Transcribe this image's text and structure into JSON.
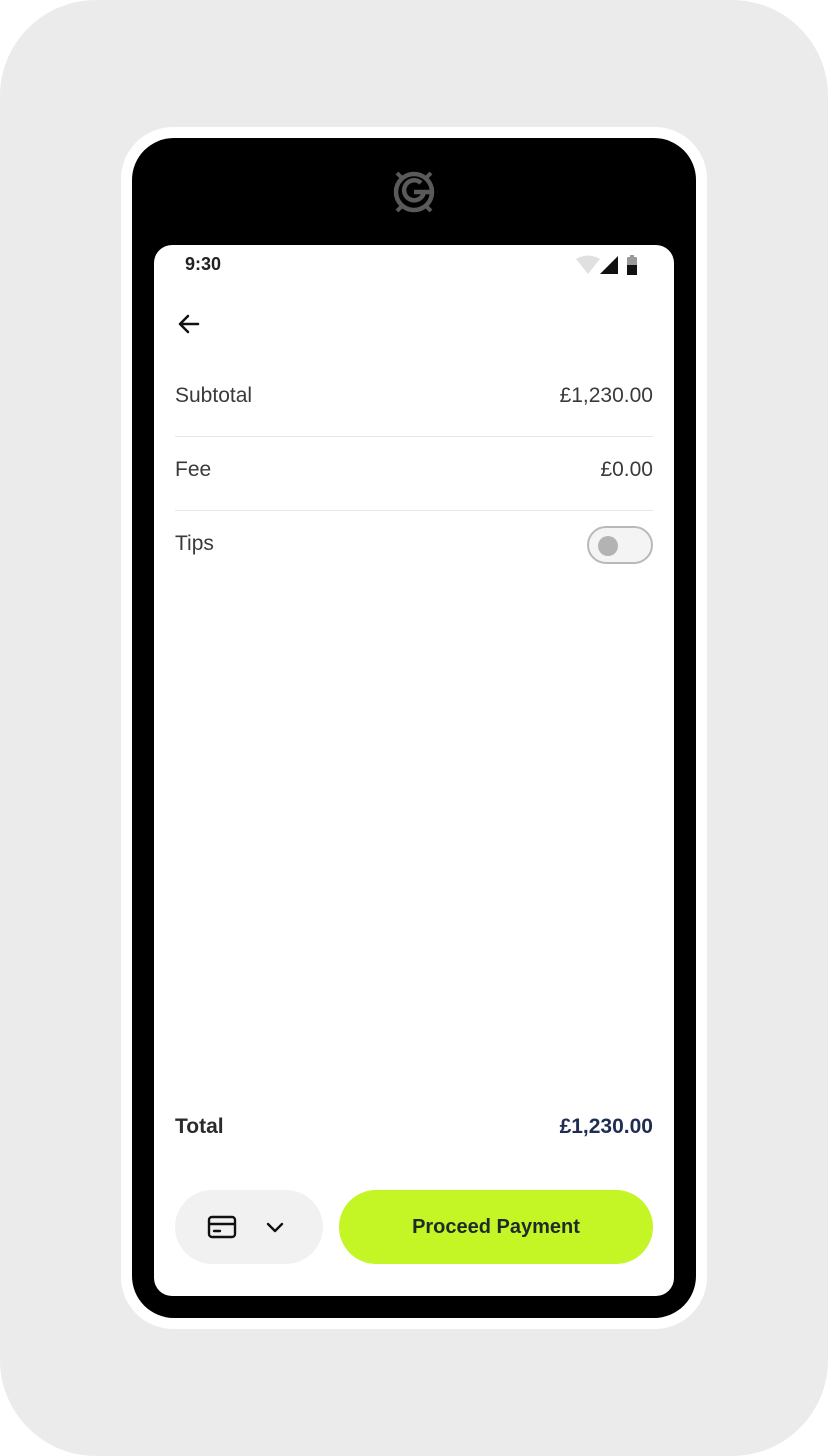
{
  "status_bar": {
    "time": "9:30",
    "icons": [
      "wifi-icon",
      "cellular-signal-icon",
      "battery-icon"
    ]
  },
  "header": {
    "back_icon": "arrow-left-icon"
  },
  "device": {
    "logo_icon": "g-logo-icon"
  },
  "summary": {
    "rows": [
      {
        "label": "Subtotal",
        "value": "£1,230.00"
      },
      {
        "label": "Fee",
        "value": "£0.00"
      }
    ],
    "tips": {
      "label": "Tips",
      "enabled": false
    }
  },
  "total": {
    "label": "Total",
    "value": "£1,230.00"
  },
  "actions": {
    "payment_method_icon": "credit-card-icon",
    "dropdown_icon": "chevron-down-icon",
    "proceed_label": "Proceed Payment"
  },
  "colors": {
    "accent": "#c4f525",
    "total_value": "#1f2d52",
    "backdrop": "#ebebeb",
    "device": "#000000"
  }
}
